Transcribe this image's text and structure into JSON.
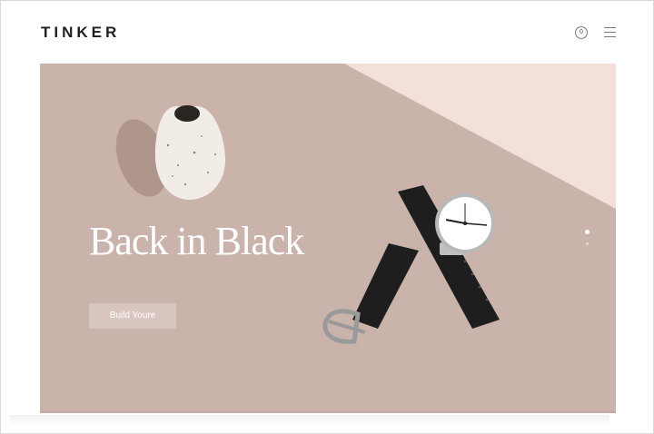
{
  "header": {
    "logo": "TINKER",
    "cart_count": "0"
  },
  "hero": {
    "headline": "Back in Black",
    "cta_label": "Build Youre"
  },
  "slider": {
    "total_slides": 2,
    "active_slide": 1
  },
  "colors": {
    "hero_background": "#c9b3aa",
    "hero_light_corner": "#f3e0d8",
    "button_background": "#d8c5bd",
    "logo_text": "#1f1f1f",
    "watch_strap": "#1e1e1e"
  },
  "icons": {
    "cart": "cart-count-icon",
    "menu": "hamburger-menu-icon"
  }
}
